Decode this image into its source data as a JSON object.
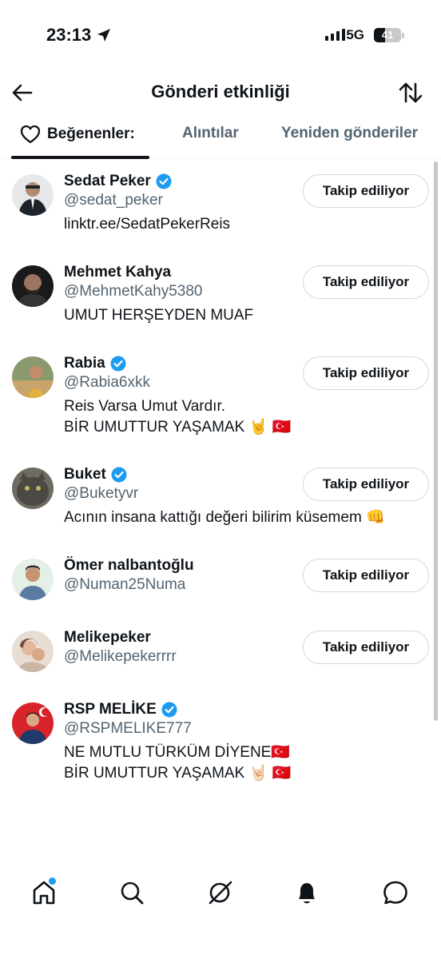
{
  "status_bar": {
    "time": "23:13",
    "network": "5G",
    "battery": "41",
    "battery_level": 0.41
  },
  "header": {
    "title": "Gönderi etkinliği"
  },
  "tabs": [
    {
      "label": "Beğenenler:"
    },
    {
      "label": "Alıntılar"
    },
    {
      "label": "Yeniden gönderiler"
    }
  ],
  "users": [
    {
      "name": "Sedat Peker",
      "handle": "@sedat_peker",
      "verified": true,
      "bio": "linktr.ee/SedatPekerReis",
      "button": "Takip ediliyor"
    },
    {
      "name": "Mehmet Kahya",
      "handle": "@MehmetKahy5380",
      "verified": false,
      "bio": "UMUT HERŞEYDEN MUAF",
      "button": "Takip ediliyor"
    },
    {
      "name": "Rabia",
      "handle": "@Rabia6xkk",
      "verified": true,
      "bio": "Reis Varsa Umut Vardır.\nBİR UMUTTUR YAŞAMAK 🤘 🇹🇷",
      "button": "Takip ediliyor"
    },
    {
      "name": "Buket",
      "handle": "@Buketyvr",
      "verified": true,
      "bio": "Acının insana kattığı değeri bilirim küsemem 👊",
      "button": "Takip ediliyor"
    },
    {
      "name": "Ömer nalbantoğlu",
      "handle": "@Numan25Numa",
      "verified": false,
      "bio": "",
      "button": "Takip ediliyor"
    },
    {
      "name": "Melikepeker",
      "handle": "@Melikepekerrrr",
      "verified": false,
      "bio": "",
      "button": "Takip ediliyor"
    },
    {
      "name": "RSP MELİKE",
      "handle": "@RSPMELIKE777",
      "verified": true,
      "bio": "NE MUTLU TÜRKÜM DİYENE🇹🇷\nBİR UMUTTUR YAŞAMAK 🤘🏻 🇹🇷",
      "button": ""
    }
  ],
  "icons": {
    "back": "arrow-left-icon",
    "sort": "sort-arrows-icon",
    "like": "heart-icon",
    "nav": [
      "home-icon",
      "search-icon",
      "grok-icon",
      "notifications-icon",
      "messages-icon"
    ]
  },
  "colors": {
    "accent": "#1d9bf0",
    "text": "#0f1419",
    "secondary": "#536471"
  }
}
